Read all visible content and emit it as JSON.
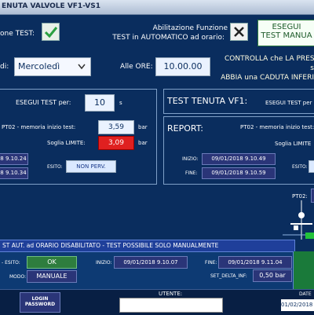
{
  "window": {
    "title": "ENUTA VALVOLE VF1-VS1"
  },
  "top": {
    "test_label": "one TEST:",
    "auto_line1": "Abilitazione Funzione",
    "auto_line2": "TEST in AUTOMATICO ad orario:",
    "esegui_line1": "ESEGUI",
    "esegui_line2": "TEST MANUA"
  },
  "schedule": {
    "day_label": "di:",
    "day_value": "Mercoledì",
    "ore_label": "Alle ORE:",
    "ore_value": "10.00.00",
    "warn_line1": "CONTROLLA che LA PRES",
    "warn_line2": "s",
    "warn_line3": "ABBIA una CADUTA INFERI"
  },
  "left_panel": {
    "esegui_label": "ESEGUI TEST per:",
    "esegui_value": "10",
    "esegui_unit": "s",
    "memoria_label": "PT02 - memoria inizio test:",
    "memoria_value": "3,59",
    "memoria_unit": "bar",
    "soglia_label": "Soglia LIMITE:",
    "soglia_value": "3,09",
    "soglia_unit": "bar",
    "date1": "8 9.10.24",
    "date2": "8 9.10.34",
    "esito_label": "ESITO:",
    "esito_value": "NON PERV."
  },
  "right_panel": {
    "title": "TEST TENUTA VF1:",
    "esegui_label": "ESEGUI TEST per",
    "report_label": "REPORT:",
    "memoria_label": "PT02 - memoria inizio test:",
    "soglia_label": "Soglia LIMITE",
    "inizio_label": "INIZIO:",
    "inizio_value": "09/01/2018 9.10.49",
    "fine_label": "FINE:",
    "fine_value": "09/01/2018 9.10.59",
    "esito_label": "ESITO:",
    "pt02_label": "PT02:"
  },
  "status": {
    "banner": "ST AUT. ad ORARIO DISABILITATO - TEST POSSIBILE SOLO MANUALMENTE",
    "esito_label": "- ESITO:",
    "esito_value": "OK",
    "modo_label": "MODO:",
    "modo_value": "MANUALE",
    "inizio_label": "INIZIO:",
    "inizio_value": "09/01/2018 9.10.07",
    "fine_label": "FINE:",
    "fine_value": "09/01/2018 9.11.04",
    "delta_label": "SET_DELTA_INF:",
    "delta_value": "0,50 bar"
  },
  "footer": {
    "login_line1": "LOGIN",
    "login_line2": "PASSWORD",
    "utente_label": "UTENTE:",
    "utente_value": "",
    "date_label": "DATE",
    "date_value": "01/02/2018"
  },
  "colors": {
    "background": "#0a2d5e",
    "green_button": "#2e7d3e",
    "red_value": "#e02020",
    "value_bg": "#eaf2ff",
    "navy_field": "#2a3578",
    "banner": "#1f3f9a"
  }
}
